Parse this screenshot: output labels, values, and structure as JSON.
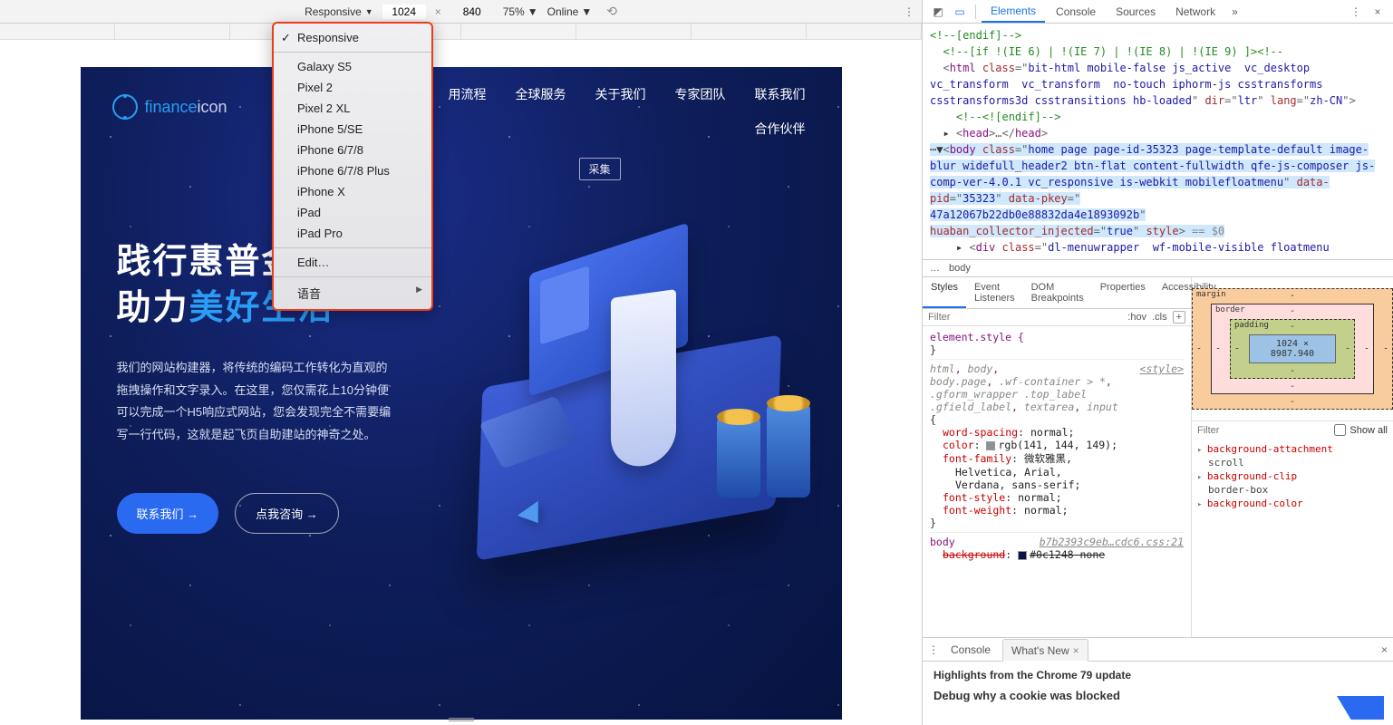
{
  "deviceToolbar": {
    "mode": "Responsive",
    "width": "1024",
    "height": "840",
    "zoom": "75%",
    "network": "Online"
  },
  "deviceMenu": {
    "items": [
      "Responsive",
      "Galaxy S5",
      "Pixel 2",
      "Pixel 2 XL",
      "iPhone 5/SE",
      "iPhone 6/7/8",
      "iPhone 6/7/8 Plus",
      "iPhone X",
      "iPad",
      "iPad Pro"
    ],
    "edit": "Edit…",
    "voice": "语音",
    "selected": "Responsive"
  },
  "website": {
    "logo1": "finance",
    "logo2": "icon",
    "nav1": [
      "用流程",
      "全球服务",
      "关于我们",
      "专家团队",
      "联系我们"
    ],
    "nav2": [
      "合作伙伴"
    ],
    "caiji": "采集",
    "headline_l1": "践行惠普金",
    "headline_l2a": "助力",
    "headline_l2b": "美好生活",
    "body": "我们的网站构建器，将传统的编码工作转化为直观的拖拽操作和文字录入。在这里，您仅需花上10分钟便可以完成一个H5响应式网站，您会发现完全不需要编写一行代码，这就是起飞页自助建站的神奇之处。",
    "cta1": "联系我们 →",
    "cta2": "点我咨询 →"
  },
  "devTabs": [
    "Elements",
    "Console",
    "Sources",
    "Network"
  ],
  "devTabActive": "Elements",
  "elements": {
    "l0": "<!--[endif]-->",
    "l1a": "<!--[if !(IE 6) | !(IE 7) | !(IE 8) | !(IE 9) ]>",
    "l1b": "<!--",
    "htmlClass": "bit-html mobile-false js_active  vc_desktop vc_transform  vc_transform  no-touch iphorm-js csstransforms csstransforms3d csstransitions hb-loaded",
    "dir": "ltr",
    "lang": "zh-CN",
    "endifComment": "<!--<![endif]-->",
    "headClose": "<head>…</head>",
    "bodyClass": "home page page-id-35323 page-template-default image-blur widefull_header2 btn-flat content-fullwidth qfe-js-composer js-comp-ver-4.0.1 vc_responsive is-webkit mobilefloatmenu",
    "dataPid": "35323",
    "dataPkey": "47a12067b22db0e88832da4e1893092b",
    "huaban": "true",
    "styleTail": " == $0",
    "divClass": "dl-menuwrapper  wf-mobile-visible floatmenu"
  },
  "breadcrumb": [
    "…",
    "body"
  ],
  "stylesTabs": [
    "Styles",
    "Event Listeners",
    "DOM Breakpoints",
    "Properties",
    "Accessibility"
  ],
  "stylesFilter": {
    "placeholder": "Filter",
    "hov": ":hov",
    "cls": ".cls",
    "plus": "+"
  },
  "cssRules": {
    "elemStyle": "element.style {",
    "close": "}",
    "sel2": "html, body, body.page, .wf-container > *, .gform_wrapper .top_label .gfield_label, textarea, input {",
    "styleLink": "<style>",
    "p_ws": "word-spacing",
    "v_ws": "normal;",
    "p_col": "color",
    "v_col_hex": "#8d9095",
    "v_col": "rgb(141, 144, 149);",
    "p_ff": "font-family",
    "v_ff1": "微软雅黑,",
    "v_ff2": "Helvetica, Arial,",
    "v_ff3": "Verdana, sans-serif;",
    "p_fs": "font-style",
    "v_fs": "normal;",
    "p_fw": "font-weight",
    "v_fw": "normal;",
    "sel3": "body",
    "link3": "b7b2393c9eb…cdc6.css:21",
    "p_bg": "background",
    "v_bg": "#0c1248 none"
  },
  "boxModel": {
    "margin": "margin",
    "border": "border",
    "padding": "padding",
    "content": "1024 × 8987.940",
    "dash": "-"
  },
  "computedFilter": {
    "placeholder": "Filter",
    "showAll": "Show all"
  },
  "computed": [
    {
      "k": "background-attachment",
      "v": "scroll"
    },
    {
      "k": "background-clip",
      "v": "border-box"
    },
    {
      "k": "background-color",
      "v": ""
    }
  ],
  "drawer": {
    "tabs": [
      "Console",
      "What's New"
    ],
    "active": "What's New",
    "highlights": "Highlights from the Chrome 79 update",
    "heading": "Debug why a cookie was blocked"
  }
}
